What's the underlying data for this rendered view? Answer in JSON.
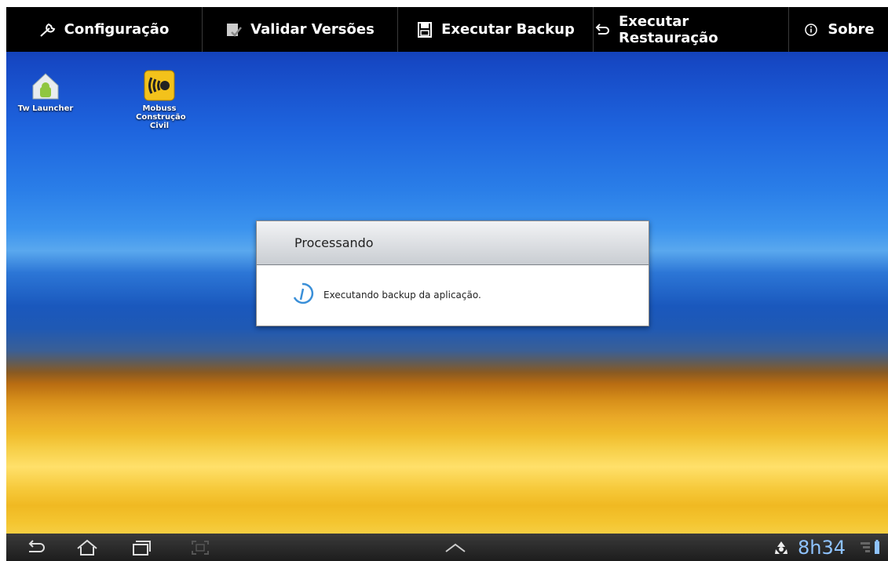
{
  "topbar": {
    "items": [
      {
        "label": "Configuração",
        "icon": "wrench-icon"
      },
      {
        "label": "Validar Versões",
        "icon": "check-document-icon"
      },
      {
        "label": "Executar Backup",
        "icon": "save-disk-icon"
      },
      {
        "label": "Executar Restauração",
        "icon": "undo-arrow-icon"
      },
      {
        "label": "Sobre",
        "icon": "info-icon"
      }
    ]
  },
  "desktop": {
    "icons": [
      {
        "label": "Tw Launcher",
        "icon": "android-home-icon"
      },
      {
        "label": "Mobuss Construção Civil",
        "icon": "mobuss-app-icon"
      }
    ]
  },
  "dialog": {
    "title": "Processando",
    "message": "Executando backup da aplicação.",
    "spinner": "loading-spinner-icon"
  },
  "statusbar": {
    "time": "8h34",
    "icons": [
      "back-icon",
      "home-icon",
      "recent-apps-icon",
      "screenshot-icon",
      "up-chevron-icon",
      "recycle-icon",
      "signal-icon",
      "battery-icon"
    ]
  },
  "colors": {
    "topbar_bg": "#000000",
    "clock_color": "#8fc3ff",
    "spinner_color": "#3a8fd8"
  }
}
